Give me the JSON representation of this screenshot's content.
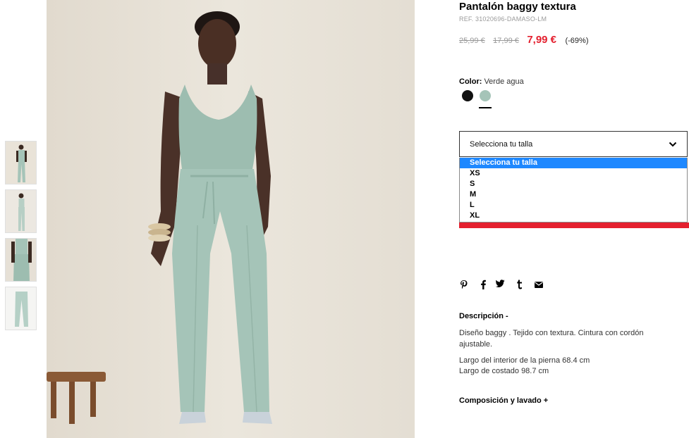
{
  "product": {
    "title": "Pantalón baggy textura",
    "ref": "REF. 31020696-DAMASO-LM",
    "prices": {
      "original": "25,99 €",
      "previous": "17,99 €",
      "sale": "7,99 €",
      "discount": "(-69%)"
    },
    "color": {
      "label": "Color:",
      "value": "Verde agua",
      "swatches": [
        {
          "name": "black",
          "hex": "#111111"
        },
        {
          "name": "verde-agua",
          "hex": "#a5c4b8",
          "selected": true
        }
      ]
    },
    "size_select": {
      "placeholder": "Selecciona tu talla",
      "options": [
        "Selecciona tu talla",
        "XS",
        "S",
        "M",
        "L",
        "XL"
      ],
      "highlighted": "Selecciona tu talla"
    },
    "share_icons": [
      "pinterest-icon",
      "facebook-icon",
      "twitter-icon",
      "tumblr-icon",
      "email-icon"
    ],
    "description": {
      "heading": "Descripción -",
      "p1": "Diseño baggy . Tejido con textura. Cintura con cordón ajustable.",
      "p2": "Largo del interior de la pierna 68.4 cm",
      "p3": "Largo de costado 98.7 cm"
    },
    "composition_heading": "Composición y lavado +"
  },
  "colors": {
    "sale_red": "#e4202f",
    "highlight_blue": "#1e88ff",
    "garment": "#a5c4b8"
  }
}
